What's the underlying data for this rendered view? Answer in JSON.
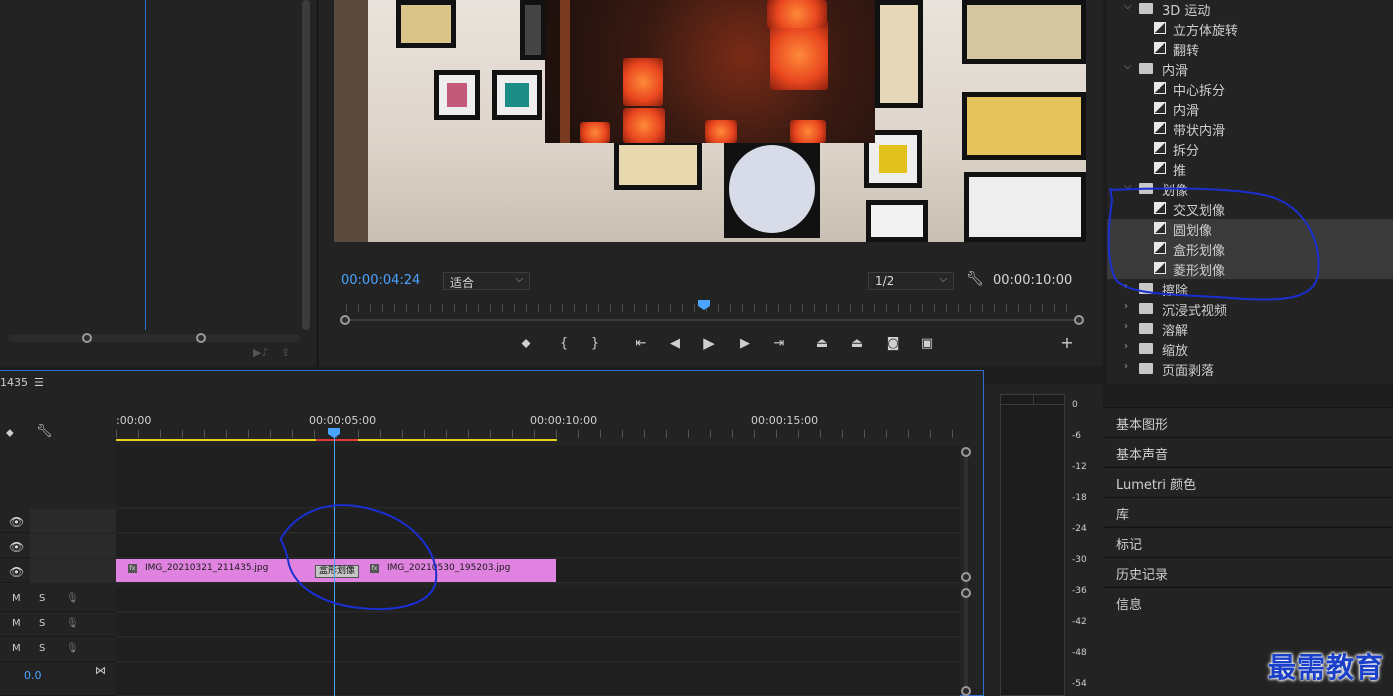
{
  "program": {
    "current_timecode": "00:00:04:24",
    "fit_label": "适合",
    "resolution_label": "1/2",
    "duration_timecode": "00:00:10:00"
  },
  "effects": {
    "rows": [
      {
        "type": "folder",
        "label": "3D 运动",
        "expanded": true
      },
      {
        "type": "item",
        "label": "立方体旋转"
      },
      {
        "type": "item",
        "label": "翻转"
      },
      {
        "type": "folder",
        "label": "内滑",
        "expanded": true
      },
      {
        "type": "item",
        "label": "中心拆分"
      },
      {
        "type": "item",
        "label": "内滑"
      },
      {
        "type": "item",
        "label": "带状内滑"
      },
      {
        "type": "item",
        "label": "拆分"
      },
      {
        "type": "item",
        "label": "推"
      },
      {
        "type": "folder",
        "label": "划像",
        "expanded": true
      },
      {
        "type": "item",
        "label": "交叉划像"
      },
      {
        "type": "item",
        "label": "圆划像",
        "selected": true
      },
      {
        "type": "item",
        "label": "盒形划像",
        "selected": true
      },
      {
        "type": "item",
        "label": "菱形划像",
        "selected": true
      },
      {
        "type": "folder",
        "label": "擦除",
        "expanded": false
      },
      {
        "type": "folder",
        "label": "沉浸式视频",
        "expanded": false
      },
      {
        "type": "folder",
        "label": "溶解",
        "expanded": false
      },
      {
        "type": "folder",
        "label": "缩放",
        "expanded": false
      },
      {
        "type": "folder",
        "label": "页面剥落",
        "expanded": false
      }
    ]
  },
  "panels": [
    "基本图形",
    "基本声音",
    "Lumetri 颜色",
    "库",
    "标记",
    "历史记录",
    "信息"
  ],
  "timeline": {
    "sequence_name": "1435",
    "ruler": [
      ":00:00",
      "00:00:05:00",
      "00:00:10:00",
      "00:00:15:00"
    ],
    "clips": [
      {
        "label": "IMG_20210321_211435.jpg"
      },
      {
        "label": "IMG_20210530_195203.jpg"
      }
    ],
    "transition_label": "盒形划像",
    "audio_track": {
      "mute": "M",
      "solo": "S"
    },
    "master_volume": "0.0"
  },
  "meter": {
    "scale": [
      "0",
      "-6",
      "-12",
      "-18",
      "-24",
      "-30",
      "-36",
      "-42",
      "-48",
      "-54"
    ]
  },
  "watermark": "最需教育",
  "icons": {
    "marker": "marker-icon",
    "mark-in": "mark-in-icon",
    "mark-out": "mark-out-icon",
    "go-to-in": "go-to-in-icon",
    "step-back": "step-back-icon",
    "play": "play-icon",
    "step-forward": "step-forward-icon",
    "go-to-out": "go-to-out-icon",
    "lift": "lift-icon",
    "extract": "extract-icon",
    "export-frame": "camera-icon",
    "compare": "compare-icon",
    "add": "plus-icon",
    "wrench": "wrench-icon",
    "eye": "eye-icon"
  },
  "colors": {
    "accent": "#4aa3ff",
    "clip": "#e083e0",
    "work_area": "#e6d21c",
    "annotation": "#1a2fd0"
  }
}
